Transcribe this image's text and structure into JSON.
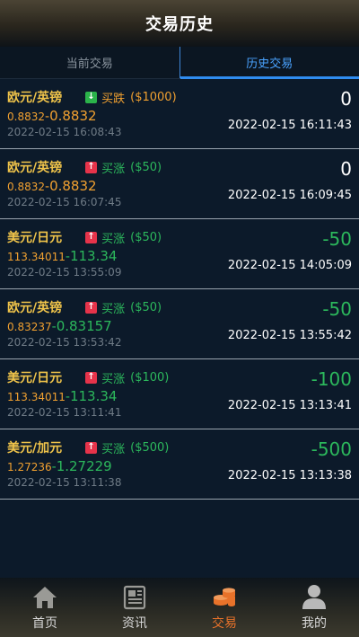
{
  "header": {
    "title": "交易历史"
  },
  "tabs": [
    {
      "label": "当前交易",
      "active": false
    },
    {
      "label": "历史交易",
      "active": true
    }
  ],
  "trades": [
    {
      "pair": "欧元/英镑",
      "direction": "down",
      "direction_label": "买跌",
      "amount": "($1000)",
      "open_price": "0.8832",
      "close_price": "0.8832",
      "close_color": "orange",
      "open_time": "2022-02-15 16:08:43",
      "pnl": "0",
      "pnl_type": "zero",
      "close_time": "2022-02-15 16:11:43"
    },
    {
      "pair": "欧元/英镑",
      "direction": "up",
      "direction_label": "买涨",
      "amount": "($50)",
      "open_price": "0.8832",
      "close_price": "0.8832",
      "close_color": "orange",
      "open_time": "2022-02-15 16:07:45",
      "pnl": "0",
      "pnl_type": "zero",
      "close_time": "2022-02-15 16:09:45"
    },
    {
      "pair": "美元/日元",
      "direction": "up",
      "direction_label": "买涨",
      "amount": "($50)",
      "open_price": "113.34011",
      "close_price": "113.34",
      "close_color": "green",
      "open_time": "2022-02-15 13:55:09",
      "pnl": "-50",
      "pnl_type": "neg",
      "close_time": "2022-02-15 14:05:09"
    },
    {
      "pair": "欧元/英镑",
      "direction": "up",
      "direction_label": "买涨",
      "amount": "($50)",
      "open_price": "0.83237",
      "close_price": "0.83157",
      "close_color": "green",
      "open_time": "2022-02-15 13:53:42",
      "pnl": "-50",
      "pnl_type": "neg",
      "close_time": "2022-02-15 13:55:42"
    },
    {
      "pair": "美元/日元",
      "direction": "up",
      "direction_label": "买涨",
      "amount": "($100)",
      "open_price": "113.34011",
      "close_price": "113.34",
      "close_color": "green",
      "open_time": "2022-02-15 13:11:41",
      "pnl": "-100",
      "pnl_type": "neg",
      "close_time": "2022-02-15 13:13:41"
    },
    {
      "pair": "美元/加元",
      "direction": "up",
      "direction_label": "买涨",
      "amount": "($500)",
      "open_price": "1.27236",
      "close_price": "1.27229",
      "close_color": "green",
      "open_time": "2022-02-15 13:11:38",
      "pnl": "-500",
      "pnl_type": "neg",
      "close_time": "2022-02-15 13:13:38"
    }
  ],
  "bottom_nav": [
    {
      "label": "首页",
      "icon": "home-icon",
      "active": false
    },
    {
      "label": "资讯",
      "icon": "news-icon",
      "active": false
    },
    {
      "label": "交易",
      "icon": "coins-icon",
      "active": true
    },
    {
      "label": "我的",
      "icon": "user-icon",
      "active": false
    }
  ],
  "colors": {
    "accent_blue": "#2f8cf0",
    "gold": "#f0c44a",
    "orange": "#f0a030",
    "green": "#2cb85c",
    "red": "#e6334a",
    "nav_active": "#e8722a"
  }
}
